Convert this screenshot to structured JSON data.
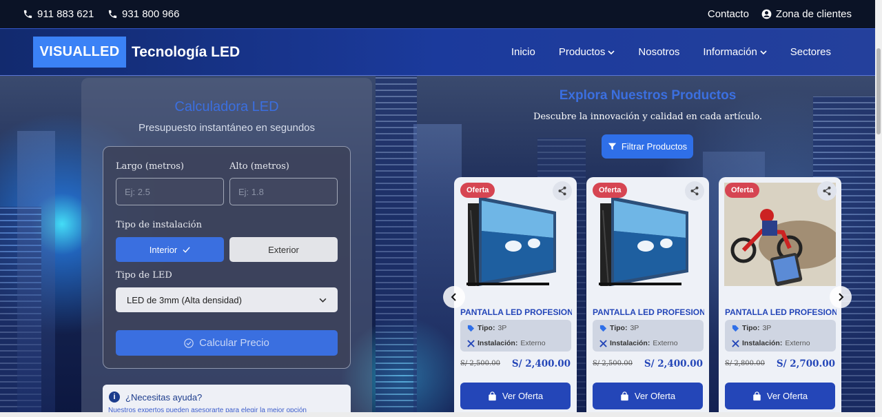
{
  "topbar": {
    "phone1": "911 883 621",
    "phone2": "931 800 966",
    "contact": "Contacto",
    "clients": "Zona de clientes"
  },
  "navbar": {
    "logo_box": "VISUALLED",
    "logo_text": "Tecnología LED",
    "items": [
      "Inicio",
      "Productos",
      "Nosotros",
      "Información",
      "Sectores"
    ]
  },
  "calculator": {
    "title": "Calculadora LED",
    "subtitle": "Presupuesto instantáneo en segundos",
    "length_label": "Largo (metros)",
    "length_placeholder": "Ej: 2.5",
    "height_label": "Alto (metros)",
    "height_placeholder": "Ej: 1.8",
    "install_label": "Tipo de instalación",
    "install_options": [
      "Interior",
      "Exterior"
    ],
    "install_selected": "Interior",
    "led_label": "Tipo de LED",
    "led_selected": "LED de 3mm (Alta densidad)",
    "submit": "Calcular Precio",
    "help_title": "¿Necesitas ayuda?",
    "help_text": "Nuestros expertos pueden asesorarte para elegir la mejor opción"
  },
  "products": {
    "title": "Explora Nuestros Productos",
    "subtitle": "Descubre la innovación y calidad en cada artículo.",
    "filter": "Filtrar Productos",
    "cards": [
      {
        "badge": "Oferta",
        "name": "PANTALLA LED PROFESIONAL",
        "tipo_label": "Tipo:",
        "tipo": "3P",
        "inst_label": "Instalación:",
        "inst": "Externo",
        "old_price": "S/ 2,500.00",
        "price": "S/ 2,400.00",
        "button": "Ver Oferta"
      },
      {
        "badge": "Oferta",
        "name": "PANTALLA LED PROFESIONAL",
        "tipo_label": "Tipo:",
        "tipo": "3P",
        "inst_label": "Instalación:",
        "inst": "Externo",
        "old_price": "S/ 2,500.00",
        "price": "S/ 2,400.00",
        "button": "Ver Oferta"
      },
      {
        "badge": "Oferta",
        "name": "PANTALLA LED PROFESIONAL",
        "tipo_label": "Tipo:",
        "tipo": "3P",
        "inst_label": "Instalación:",
        "inst": "Externo",
        "old_price": "S/ 2,800.00",
        "price": "S/ 2,700.00",
        "button": "Ver Oferta"
      }
    ]
  },
  "colors": {
    "accent": "#3a6fe0",
    "brand_blue": "#2446b8",
    "offer_badge": "#d64552"
  }
}
